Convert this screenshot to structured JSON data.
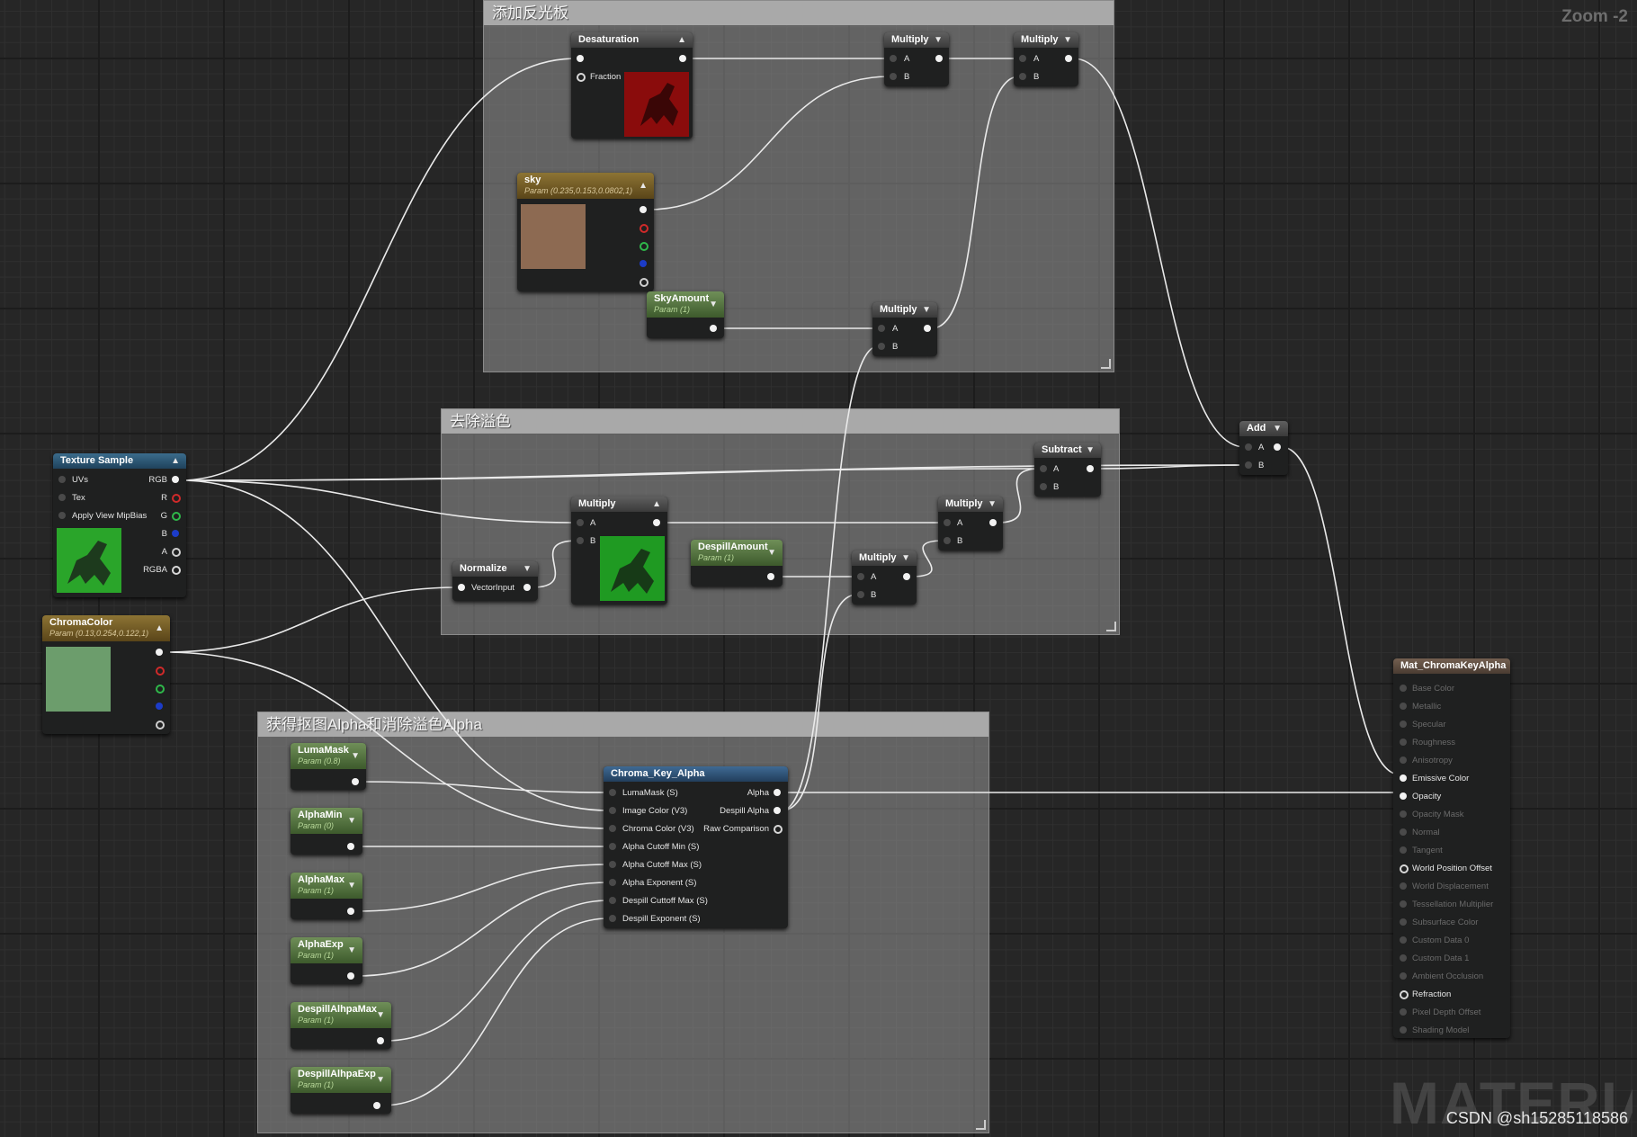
{
  "zoom_label": "Zoom -2",
  "watermark": "MATERIAL",
  "credit": "CSDN @sh15285118586",
  "comments": {
    "reflector": "添加反光板",
    "despill": "去除溢色",
    "alpha": "获得抠图Alpha和消除溢色Alpha"
  },
  "colors": {
    "sky": "#8d6a52",
    "chroma": "#6c9d6c",
    "wire": "#eaeaea",
    "param_header": "#4f7a3c",
    "vector_header": "#7a6329"
  },
  "nodes": {
    "desaturation": {
      "title": "Desaturation",
      "fraction": "Fraction"
    },
    "multiply_top1": {
      "title": "Multiply",
      "a": "A",
      "b": "B"
    },
    "multiply_top2": {
      "title": "Multiply",
      "a": "A",
      "b": "B"
    },
    "sky": {
      "title": "sky",
      "subtitle": "Param (0.235,0.153,0.0802,1)"
    },
    "sky_amount": {
      "title": "SkyAmount",
      "subtitle": "Param (1)"
    },
    "multiply_sky": {
      "title": "Multiply",
      "a": "A",
      "b": "B"
    },
    "texture_sample": {
      "title": "Texture Sample",
      "pins_in": [
        "UVs",
        "Tex",
        "Apply View MipBias"
      ],
      "pins_out": [
        "RGB",
        "R",
        "G",
        "B",
        "A",
        "RGBA"
      ]
    },
    "chroma_color": {
      "title": "ChromaColor",
      "subtitle": "Param (0.13,0.254,0.122,1)"
    },
    "normalize": {
      "title": "Normalize",
      "input": "VectorInput"
    },
    "multiply_mid": {
      "title": "Multiply",
      "a": "A",
      "b": "B"
    },
    "despill_amount": {
      "title": "DespillAmount",
      "subtitle": "Param (1)"
    },
    "multiply_despill": {
      "title": "Multiply",
      "a": "A",
      "b": "B"
    },
    "multiply_mid2": {
      "title": "Multiply",
      "a": "A",
      "b": "B"
    },
    "subtract": {
      "title": "Subtract",
      "a": "A",
      "b": "B"
    },
    "add": {
      "title": "Add",
      "a": "A",
      "b": "B"
    },
    "luma_mask": {
      "title": "LumaMask",
      "subtitle": "Param (0.8)"
    },
    "alpha_min": {
      "title": "AlphaMin",
      "subtitle": "Param (0)"
    },
    "alpha_max": {
      "title": "AlphaMax",
      "subtitle": "Param (1)"
    },
    "alpha_exp": {
      "title": "AlphaExp",
      "subtitle": "Param (1)"
    },
    "despill_alpha_max": {
      "title": "DespillAlhpaMax",
      "subtitle": "Param (1)"
    },
    "despill_alpha_exp": {
      "title": "DespillAlhpaExp",
      "subtitle": "Param (1)"
    },
    "chroma_key_alpha": {
      "title": "Chroma_Key_Alpha",
      "inputs": [
        "LumaMask (S)",
        "Image Color (V3)",
        "Chroma Color (V3)",
        "Alpha Cutoff Min (S)",
        "Alpha Cutoff Max (S)",
        "Alpha Exponent (S)",
        "Despill Cuttoff Max (S)",
        "Despill Exponent (S)"
      ],
      "outputs": [
        "Alpha",
        "Despill Alpha",
        "Raw Comparison"
      ]
    },
    "material_result": {
      "title": "Mat_ChromaKeyAlpha",
      "pins": [
        "Base Color",
        "Metallic",
        "Specular",
        "Roughness",
        "Anisotropy",
        "Emissive Color",
        "Opacity",
        "Opacity Mask",
        "Normal",
        "Tangent",
        "World Position Offset",
        "World Displacement",
        "Tessellation Multiplier",
        "Subsurface Color",
        "Custom Data 0",
        "Custom Data 1",
        "Ambient Occlusion",
        "Refraction",
        "Pixel Depth Offset",
        "Shading Model"
      ],
      "active": [
        "Emissive Color",
        "Opacity",
        "World Position Offset",
        "Refraction"
      ]
    }
  }
}
